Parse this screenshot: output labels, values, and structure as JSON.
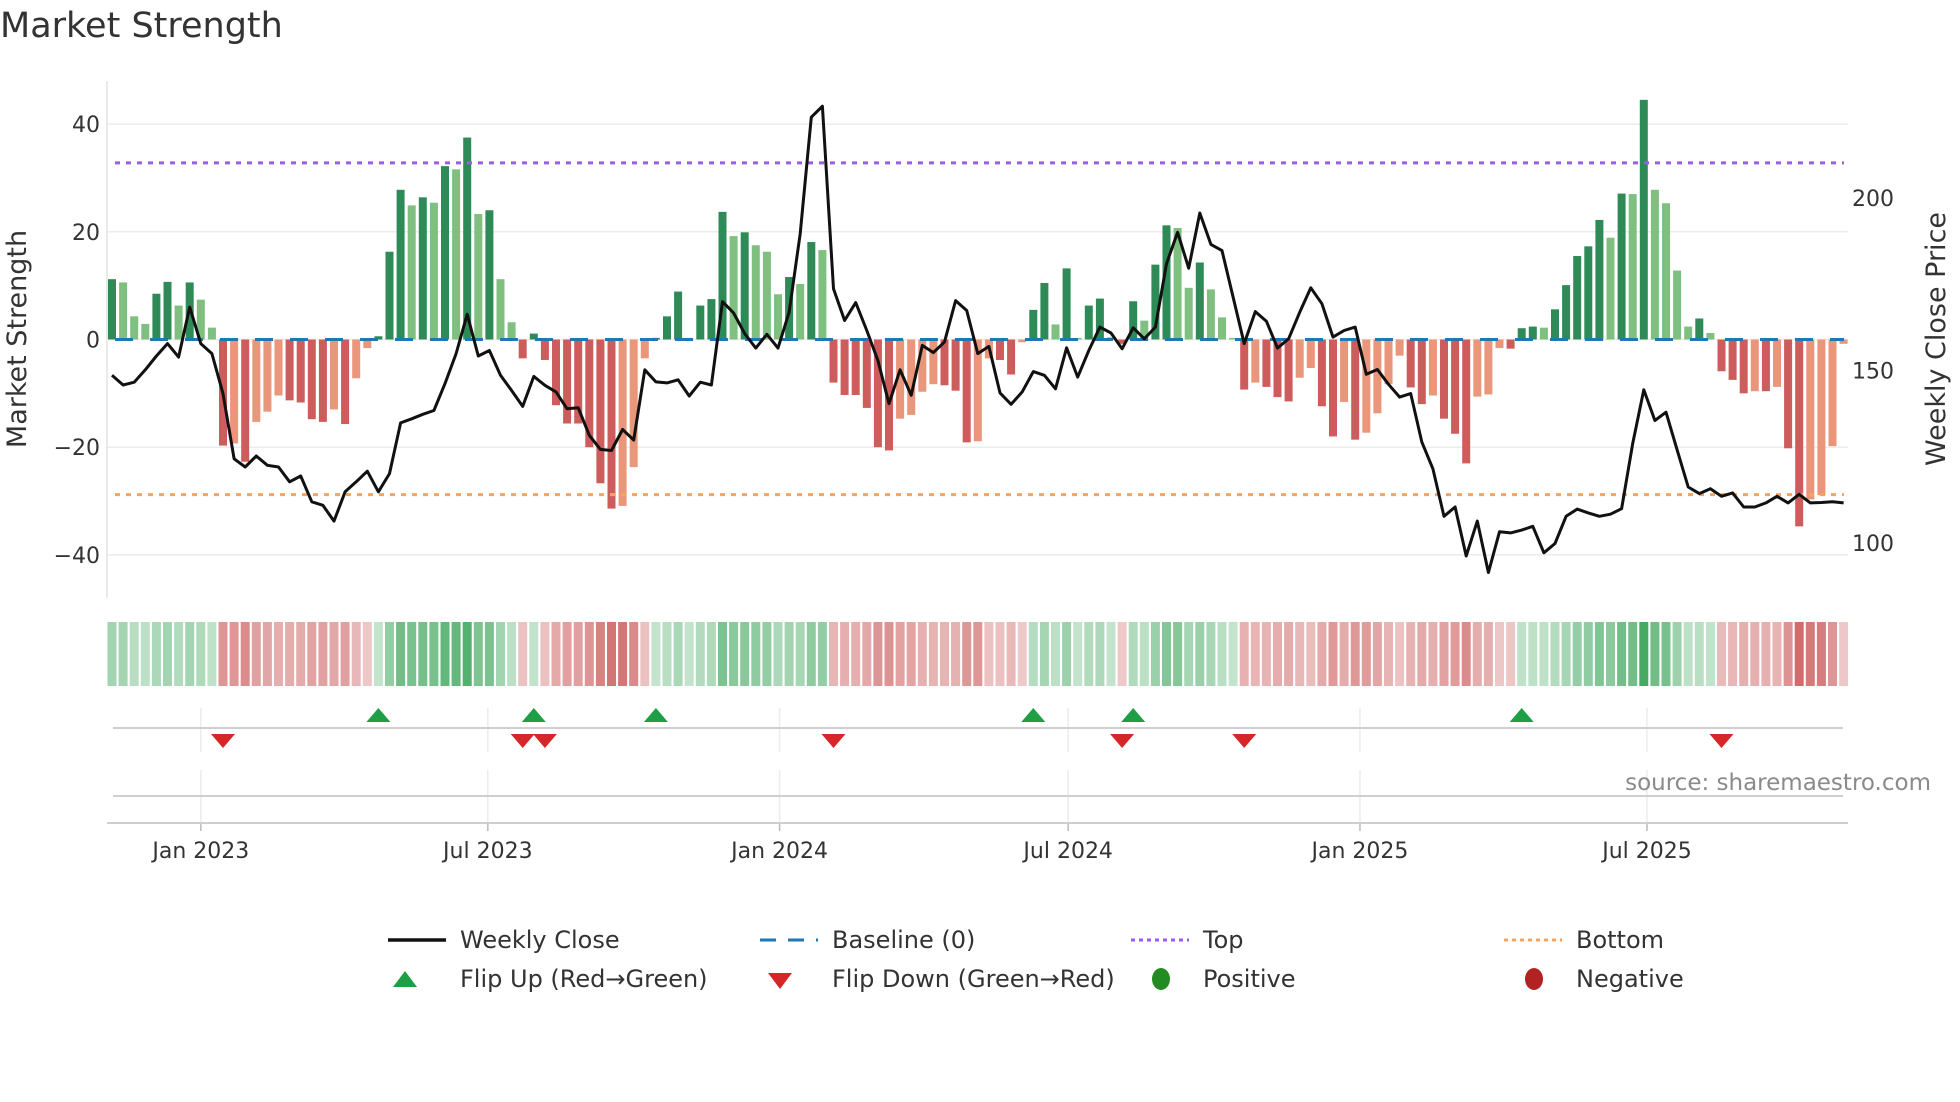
{
  "title": "Market Strength",
  "source": "source: sharemaestro.com",
  "legend": {
    "weekly_close": "Weekly Close",
    "baseline": "Baseline (0)",
    "top": "Top",
    "bottom": "Bottom",
    "flip_up": "Flip Up (Red→Green)",
    "flip_down": "Flip Down (Green→Red)",
    "positive": "Positive",
    "negative": "Negative"
  },
  "colors": {
    "pos_dark": "#2e8b57",
    "pos_light": "#7fbf7f",
    "neg_dark": "#cd5c5c",
    "neg_light": "#e9967a",
    "close": "#111111",
    "baseline": "#1f77b4",
    "top": "#9b5de5",
    "bottom": "#f4a460",
    "flip_up": "#1e9e45",
    "flip_down": "#d62728",
    "positive": "#228b22",
    "negative": "#b22222"
  },
  "chart_data": {
    "type": "bar",
    "title": "Market Strength",
    "ylabel": "Market Strength",
    "y2label": "Weekly Close Price",
    "ylim": [
      -48,
      48
    ],
    "y2lim": [
      84,
      234
    ],
    "yticks": [
      -40,
      -20,
      0,
      20,
      40
    ],
    "y2ticks": [
      100,
      150,
      200
    ],
    "xticks": [
      {
        "label": "Jan 2023",
        "date": "2023-01-01"
      },
      {
        "label": "Jul 2023",
        "date": "2023-07-01"
      },
      {
        "label": "Jan 2024",
        "date": "2024-01-01"
      },
      {
        "label": "Jul 2024",
        "date": "2024-07-01"
      },
      {
        "label": "Jan 2025",
        "date": "2025-01-01"
      },
      {
        "label": "Jul 2025",
        "date": "2025-07-01"
      }
    ],
    "start_date": "2022-11-06",
    "frequency": "weekly",
    "top_level": 32.8,
    "bottom_level": -28.8,
    "baseline": 0,
    "strength": [
      11.2,
      10.6,
      4.3,
      2.9,
      8.5,
      10.7,
      6.3,
      10.6,
      7.4,
      2.2,
      -19.7,
      -19.3,
      -22.7,
      -15.3,
      -13.4,
      -10.4,
      -11.3,
      -11.7,
      -14.8,
      -15.3,
      -13.0,
      -15.7,
      -7.2,
      -1.6,
      0.6,
      16.3,
      27.8,
      24.9,
      26.4,
      25.4,
      32.2,
      31.6,
      37.5,
      23.3,
      24.0,
      11.2,
      3.2,
      -3.5,
      1.1,
      -3.8,
      -12.2,
      -15.6,
      -15.6,
      -20,
      -26.7,
      -31.4,
      -30.9,
      -23.7,
      -3.5,
      0.3,
      4.3,
      8.9,
      0.3,
      6.3,
      7.5,
      23.7,
      19.2,
      19.9,
      17.5,
      16.3,
      8.4,
      11.6,
      10.3,
      18.1,
      16.6,
      -8,
      -10.3,
      -10.3,
      -12.7,
      -20,
      -20.6,
      -14.7,
      -14,
      -9.7,
      -8.3,
      -8.5,
      -9.5,
      -19.1,
      -18.9,
      -3.5,
      -3.8,
      -6.5,
      -0.5,
      5.5,
      10.5,
      2.8,
      13.2,
      0.3,
      6.3,
      7.6,
      0.4,
      -0.8,
      7.1,
      3.5,
      13.9,
      21.2,
      20.7,
      9.6,
      14.3,
      9.3,
      4.1,
      0.3,
      -9.3,
      -8,
      -8.8,
      -10.7,
      -11.5,
      -7.1,
      -5.3,
      -12.4,
      -18,
      -11.6,
      -18.6,
      -17.3,
      -13.7,
      -8.3,
      -3,
      -8.9,
      -12,
      -10.4,
      -14.7,
      -17.5,
      -23,
      -10.6,
      -10.2,
      -1.6,
      -1.7,
      2.1,
      2.4,
      2.2,
      5.6,
      10.1,
      15.5,
      17.3,
      22.2,
      18.9,
      27.1,
      27,
      44.5,
      27.8,
      25.3,
      12.8,
      2.4,
      3.9,
      1.2,
      -5.9,
      -7.5,
      -10,
      -9.6,
      -9.6,
      -8.8,
      -20.2,
      -34.7,
      -29.7,
      -28.9,
      -19.8,
      -0.8
    ],
    "weekly_close": [
      148.6,
      145.8,
      146.6,
      150.2,
      154.2,
      157.8,
      153.9,
      168.4,
      157.8,
      154.9,
      143.3,
      124.4,
      122,
      125.2,
      122.5,
      122,
      117.7,
      119.4,
      111.9,
      110.9,
      106.3,
      114.8,
      117.7,
      120.8,
      114.8,
      120.1,
      134.8,
      136,
      137.3,
      138.4,
      146.2,
      154.9,
      166.3,
      154.2,
      155.8,
      148.6,
      144.2,
      139.6,
      148.3,
      145.7,
      143.8,
      138.9,
      139.2,
      131.2,
      127.1,
      126.8,
      132.9,
      129.8,
      150.2,
      146.7,
      146.4,
      147.3,
      142.6,
      146.6,
      145.8,
      170,
      166.7,
      160.7,
      156.5,
      160.5,
      156.5,
      166.9,
      189.7,
      223.5,
      226.7,
      173.7,
      164.5,
      169.7,
      161.6,
      152.9,
      140.4,
      150.2,
      142.8,
      157.3,
      155.2,
      158.3,
      170.3,
      167.4,
      154.9,
      157,
      143.5,
      140.2,
      143.8,
      149.7,
      148.6,
      144.7,
      156.6,
      148.1,
      155.8,
      162.6,
      160.9,
      156.3,
      162.4,
      159.2,
      162.6,
      181,
      190.1,
      179.7,
      195.7,
      186.6,
      184.8,
      171.3,
      157.8,
      167.1,
      164.3,
      156.5,
      159.2,
      166.9,
      174,
      169.4,
      159.7,
      161.6,
      162.6,
      148.9,
      150.3,
      146,
      142.3,
      143.3,
      129.3,
      121.5,
      107.7,
      110.4,
      96.2,
      106.3,
      91.4,
      103.2,
      102.9,
      103.7,
      104.8,
      97.1,
      99.8,
      107.7,
      109.8,
      108.7,
      107.7,
      108.3,
      109.9,
      128.8,
      144.4,
      135.5,
      137.9,
      127,
      116.2,
      114.3,
      115.7,
      113.5,
      114.5,
      110.4,
      110.4,
      111.6,
      113.5,
      111.6,
      114.1,
      111.6,
      111.7,
      111.9,
      111.6
    ]
  }
}
